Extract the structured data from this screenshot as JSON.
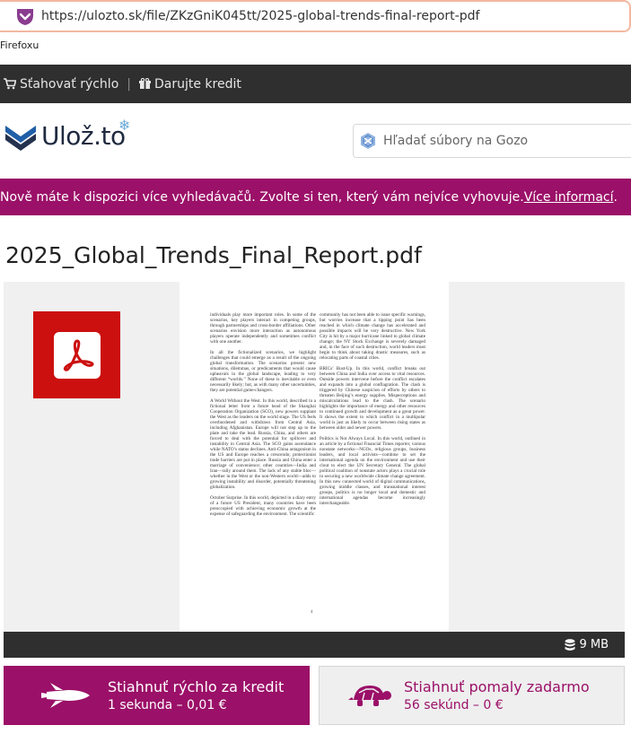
{
  "browser": {
    "url": "https://ulozto.sk/file/ZKzGniK045tt/2025-global-trends-final-report-pdf",
    "note": "Firefoxu"
  },
  "topbar": {
    "fast_download": "Sťahovať rýchlo",
    "separator": "|",
    "donate_credit": "Darujte kredit"
  },
  "header": {
    "logo_text": "Ulož.to",
    "search_placeholder": "Hľadať súbory na Gozo"
  },
  "notice": {
    "text": "Nově máte k dispozici více vyhledávačů. Zvolte si ten, který vám nejvíce vyhovuje. ",
    "link": "Více informací",
    "end": "."
  },
  "file": {
    "name": "2025_Global_Trends_Final_Report.pdf",
    "size": "9 MB"
  },
  "preview_page": {
    "left_column": [
      "individuals play more important roles. In some of the scenarios, key players interact in competing groups, through partnerships and cross-border affiliations. Other scenarios envision more interaction as autonomous players operate independently and sometimes conflict with one another.",
      "In all the fictionalized scenarios, we highlight challenges that could emerge as a result of the ongoing global transformation. The scenarios present new situations, dilemmas, or predicaments that would cause upheavals in the global landscape, leading to very different “worlds.” None of these is inevitable or even necessarily likely; but, as with many other uncertainties, they are potential game-changers.",
      "A World Without the West. In this world, described in a fictional letter from a future head of the Shanghai Cooperation Organization (SCO), new powers supplant the West as the leaders on the world stage. The US feels overburdened and withdraws from Central Asia, including Afghanistan. Europe will not step up to the plate and take the lead. Russia, China, and others are forced to deal with the potential for spillover and instability in Central Asia. The SCO gains ascendance while NATO’s status declines. Anti-China antagonism in the US and Europe reaches a crescendo; protectionist trade barriers are put in place. Russia and China enter a marriage of convenience; other countries—India and Iran—rally around them. The lack of any stable bloc—whether in the West or the non-Western world—adds to growing instability and disorder, potentially threatening globalization.",
      "October Surprise. In this world, depicted in a diary entry of a future US President, many countries have been preoccupied with achieving economic growth at the expense of safeguarding the environment. The scientific"
    ],
    "right_column": [
      "community has not been able to issue specific warnings, but worries increase that a tipping point has been reached in which climate change has accelerated and possible impacts will be very destructive. New York City is hit by a major hurricane linked to global climate change; the NY Stock Exchange is severely damaged and, in the face of such destruction, world leaders must begin to think about taking drastic measures, such as relocating parts of coastal cities.",
      "BRICs’ Bust-Up. In this world, conflict breaks out between China and India over access to vital resources. Outside powers intervene before the conflict escalates and expands into a global conflagration. The clash is triggered by Chinese suspicion of efforts by others to threaten Beijing’s energy supplies. Misperceptions and miscalculations lead to the clash. The scenario highlights the importance of energy and other resources to continued growth and development as a great power. It shows the extent to which conflict in a multipolar world is just as likely to occur between rising states as between older and newer powers.",
      "Politics is Not Always Local. In this world, outlined in an article by a fictional Financial Times reporter, various nonstate networks—NGOs, religious groups, business leaders, and local activists—combine to set the international agenda on the environment and use their clout to elect the UN Secretary General. The global political coalition of nonstate actors plays a crucial role in securing a new worldwide climate change agreement. In this new connected world of digital communications, growing middle classes, and transnational interest groups, politics is no longer local and domestic and international agendas become increasingly interchangeable."
    ],
    "page_number": "4"
  },
  "buttons": {
    "fast": {
      "title": "Stiahnuť rýchlo za kredit",
      "sub": "1 sekunda – 0,01 €"
    },
    "slow": {
      "title": "Stiahnuť pomaly zadarmo",
      "sub": "56 sekúnd – 0 €"
    }
  },
  "colors": {
    "brand": "#9b1068",
    "dark_bar": "#2f2f2f",
    "pdf_red": "#cc0f0f"
  },
  "icons": {
    "url_shield": "pocket-shield-icon",
    "cart": "cart-icon",
    "gift": "gift-icon",
    "search": "gozo-search-icon",
    "pdf": "acrobat-pdf-icon",
    "database": "database-icon",
    "rocket": "shuttle-icon",
    "turtle": "turtle-icon"
  }
}
